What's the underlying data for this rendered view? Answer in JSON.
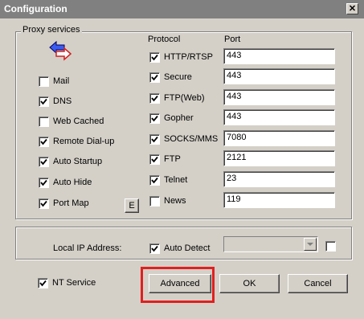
{
  "window": {
    "title": "Configuration",
    "close_glyph": "✕"
  },
  "proxy": {
    "group_label": "Proxy services",
    "icon": "exchange-arrows-icon",
    "services": [
      {
        "label": "Mail",
        "checked": false
      },
      {
        "label": "DNS",
        "checked": true
      },
      {
        "label": "Web Cached",
        "checked": false
      },
      {
        "label": "Remote Dial-up",
        "checked": true
      },
      {
        "label": "Auto Startup",
        "checked": true
      },
      {
        "label": "Auto Hide",
        "checked": true
      },
      {
        "label": "Port Map",
        "checked": true
      }
    ],
    "edit_button": "E",
    "protocol_header": "Protocol",
    "port_header": "Port",
    "protocols": [
      {
        "label": "HTTP/RTSP",
        "checked": true,
        "port": "443"
      },
      {
        "label": "Secure",
        "checked": true,
        "port": "443"
      },
      {
        "label": "FTP(Web)",
        "checked": true,
        "port": "443"
      },
      {
        "label": "Gopher",
        "checked": true,
        "port": "443"
      },
      {
        "label": "SOCKS/MMS",
        "checked": true,
        "port": "7080"
      },
      {
        "label": "FTP",
        "checked": true,
        "port": "2121"
      },
      {
        "label": "Telnet",
        "checked": true,
        "port": "23"
      },
      {
        "label": "News",
        "checked": false,
        "port": "119"
      }
    ]
  },
  "local_ip": {
    "label": "Local IP Address:",
    "auto_detect_label": "Auto Detect",
    "auto_detect_checked": true,
    "combo_value": "",
    "extra_checked": false
  },
  "nt_service": {
    "label": "NT Service",
    "checked": true
  },
  "buttons": {
    "advanced": "Advanced",
    "ok": "OK",
    "cancel": "Cancel"
  },
  "colors": {
    "titlebar": "#808080",
    "highlight": "#e02020",
    "face": "#d4d0c8"
  }
}
